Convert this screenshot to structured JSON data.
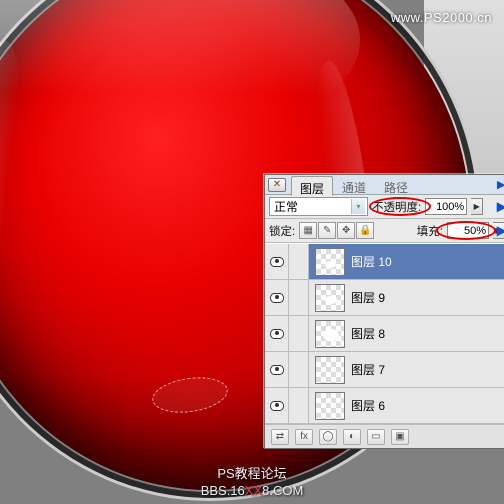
{
  "watermark_top": "www.PS2000.cn",
  "watermark_bottom_line1": "PS教程论坛",
  "watermark_bottom_prefix": "BBS.16",
  "watermark_bottom_red": "XX",
  "watermark_bottom_suffix": "8.COM",
  "panel": {
    "close_glyph": "✕",
    "tabs": {
      "layers": "图层",
      "channels": "通道",
      "paths": "路径"
    },
    "blend_mode": "正常",
    "opacity_label": "不透明度:",
    "opacity_value": "100%",
    "lock_label": "锁定:",
    "lock_icons": {
      "transparency": "▦",
      "brush": "✎",
      "move": "✥",
      "all": "🔒"
    },
    "fill_label": "填充:",
    "fill_value": "50%",
    "flyout_glyph": "▶",
    "dropdown_glyph": "▾",
    "layers": [
      {
        "name": "图层 10",
        "selected": true,
        "thumb": "top"
      },
      {
        "name": "图层 9",
        "selected": false,
        "thumb": "small"
      },
      {
        "name": "图层 8",
        "selected": false,
        "thumb": "big"
      },
      {
        "name": "图层 7",
        "selected": false,
        "thumb": "none"
      },
      {
        "name": "图层 6",
        "selected": false,
        "thumb": "none"
      }
    ],
    "footer_icons": {
      "link": "⇄",
      "fx": "fx",
      "mask": "◯",
      "adjust": "◐",
      "group": "▭",
      "new": "▣"
    }
  },
  "chart_data": null
}
